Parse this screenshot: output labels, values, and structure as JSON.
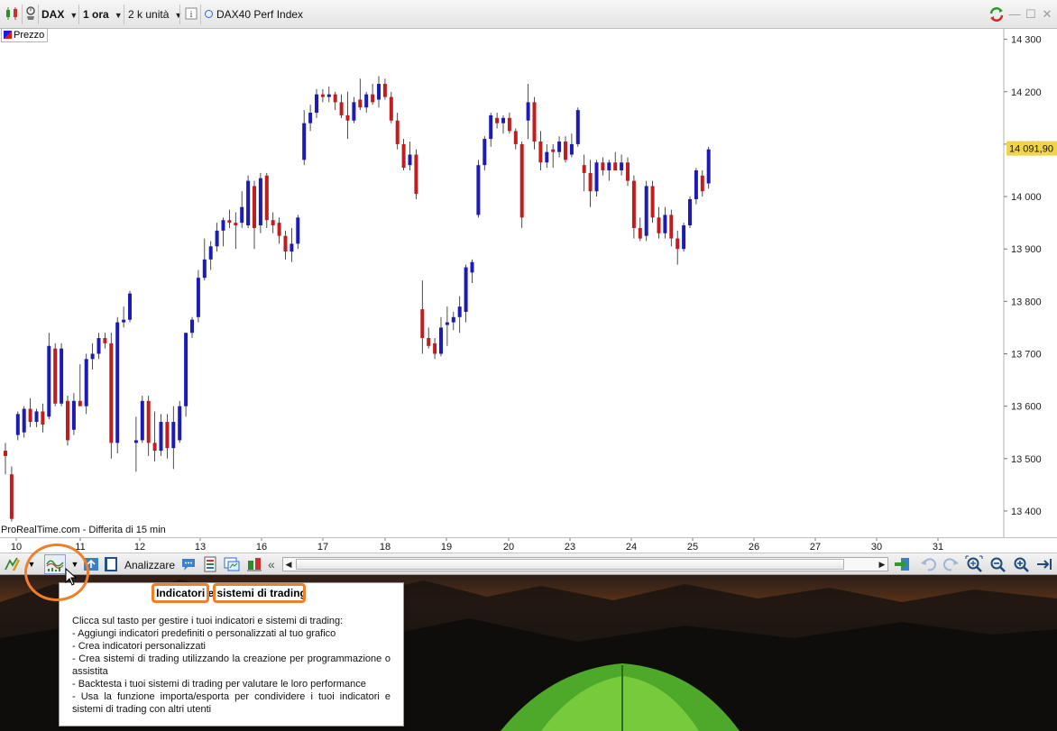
{
  "topbar": {
    "symbol": "DAX",
    "timeframe": "1 ora",
    "units": "2 k unità",
    "instrument": "DAX40 Perf Index",
    "icons": [
      "chart-type-icon",
      "alert-icon",
      "info-icon",
      "sync-icon",
      "minimize-icon",
      "maximize-icon",
      "close-icon"
    ]
  },
  "chart": {
    "legend_label": "Prezzo",
    "credit": "ProRealTime.com - Differita di 15 min",
    "last_price_label": "14 091,90",
    "y_ticks": [
      {
        "value": 14300,
        "label": "14 300"
      },
      {
        "value": 14200,
        "label": "14 200"
      },
      {
        "value": 14100,
        "label": "14 100"
      },
      {
        "value": 14000,
        "label": "14 000"
      },
      {
        "value": 13900,
        "label": "13 900"
      },
      {
        "value": 13800,
        "label": "13 800"
      },
      {
        "value": 13700,
        "label": "13 700"
      },
      {
        "value": 13600,
        "label": "13 600"
      },
      {
        "value": 13500,
        "label": "13 500"
      },
      {
        "value": 13400,
        "label": "13 400"
      }
    ],
    "x_ticks": [
      "10",
      "11",
      "12",
      "13",
      "16",
      "17",
      "18",
      "19",
      "20",
      "23",
      "24",
      "25",
      "26",
      "27",
      "30",
      "31"
    ],
    "colors": {
      "up": "#1c1cb4",
      "down": "#c01e1e",
      "accent": "#f07f2a",
      "price_label_bg": "#f0d54a"
    }
  },
  "toolbar": {
    "analyze_label": "Analizzare",
    "icons": [
      "drawing-tools-icon",
      "indicators-icon",
      "arrange-icon",
      "book-icon",
      "comment-icon",
      "report-icon",
      "screener-icon",
      "trading-systems-icon",
      "collapse-icon",
      "sync-arrows-icon",
      "undo-icon",
      "redo-icon",
      "zoom-fit-icon",
      "zoom-out-icon",
      "zoom-in-icon",
      "scroll-end-icon"
    ]
  },
  "tooltip": {
    "title_part1": "Indicatori",
    "title_mid": " e ",
    "title_part2": "sistemi di trading",
    "lines": [
      "Clicca sul tasto per gestire i tuoi indicatori e sistemi di trading:",
      "- Aggiungi indicatori predefiniti o personalizzati al tuo grafico",
      "- Crea indicatori personalizzati",
      "- Crea sistemi di trading utilizzando la creazione per programmazione o assistita",
      "- Backtesta i tuoi sistemi di trading per valutare le loro performance",
      "- Usa la funzione importa/esporta per condividere i tuoi indicatori e sistemi di trading con altri utenti"
    ]
  },
  "chart_data": {
    "type": "candlestick",
    "ylim": [
      13350,
      14320
    ],
    "x_session_labels": [
      "10",
      "11",
      "12",
      "13",
      "16",
      "17",
      "18",
      "19",
      "20",
      "23",
      "24",
      "25",
      "26"
    ],
    "candles": [
      {
        "o": 13515,
        "h": 13530,
        "l": 13470,
        "c": 13505
      },
      {
        "o": 13470,
        "h": 13485,
        "l": 13380,
        "c": 13385
      },
      {
        "o": 13545,
        "h": 13590,
        "l": 13535,
        "c": 13585
      },
      {
        "o": 13550,
        "h": 13600,
        "l": 13540,
        "c": 13595
      },
      {
        "o": 13595,
        "h": 13615,
        "l": 13560,
        "c": 13570
      },
      {
        "o": 13570,
        "h": 13595,
        "l": 13560,
        "c": 13590
      },
      {
        "o": 13590,
        "h": 13605,
        "l": 13550,
        "c": 13565
      },
      {
        "o": 13580,
        "h": 13740,
        "l": 13575,
        "c": 13715
      },
      {
        "o": 13710,
        "h": 13720,
        "l": 13600,
        "c": 13605
      },
      {
        "o": 13605,
        "h": 13720,
        "l": 13600,
        "c": 13710
      },
      {
        "o": 13610,
        "h": 13620,
        "l": 13525,
        "c": 13535
      },
      {
        "o": 13555,
        "h": 13625,
        "l": 13545,
        "c": 13610
      },
      {
        "o": 13610,
        "h": 13680,
        "l": 13600,
        "c": 13600
      },
      {
        "o": 13600,
        "h": 13700,
        "l": 13585,
        "c": 13690
      },
      {
        "o": 13690,
        "h": 13720,
        "l": 13670,
        "c": 13700
      },
      {
        "o": 13700,
        "h": 13740,
        "l": 13690,
        "c": 13730
      },
      {
        "o": 13730,
        "h": 13740,
        "l": 13710,
        "c": 13720
      },
      {
        "o": 13720,
        "h": 13740,
        "l": 13500,
        "c": 13530
      },
      {
        "o": 13530,
        "h": 13770,
        "l": 13510,
        "c": 13760
      },
      {
        "o": 13760,
        "h": 13790,
        "l": 13750,
        "c": 13765
      },
      {
        "o": 13765,
        "h": 13820,
        "l": 13760,
        "c": 13815
      },
      {
        "o": 13530,
        "h": 13580,
        "l": 13475,
        "c": 13535
      },
      {
        "o": 13535,
        "h": 13620,
        "l": 13530,
        "c": 13610
      },
      {
        "o": 13610,
        "h": 13620,
        "l": 13505,
        "c": 13530
      },
      {
        "o": 13530,
        "h": 13590,
        "l": 13495,
        "c": 13515
      },
      {
        "o": 13515,
        "h": 13585,
        "l": 13505,
        "c": 13570
      },
      {
        "o": 13570,
        "h": 13585,
        "l": 13500,
        "c": 13520
      },
      {
        "o": 13520,
        "h": 13600,
        "l": 13480,
        "c": 13570
      },
      {
        "o": 13535,
        "h": 13610,
        "l": 13530,
        "c": 13600
      },
      {
        "o": 13600,
        "h": 13740,
        "l": 13580,
        "c": 13740
      },
      {
        "o": 13740,
        "h": 13770,
        "l": 13730,
        "c": 13765
      },
      {
        "o": 13770,
        "h": 13860,
        "l": 13760,
        "c": 13845
      },
      {
        "o": 13845,
        "h": 13920,
        "l": 13840,
        "c": 13880
      },
      {
        "o": 13880,
        "h": 13915,
        "l": 13860,
        "c": 13905
      },
      {
        "o": 13905,
        "h": 13950,
        "l": 13895,
        "c": 13935
      },
      {
        "o": 13935,
        "h": 13960,
        "l": 13905,
        "c": 13955
      },
      {
        "o": 13955,
        "h": 13975,
        "l": 13940,
        "c": 13950
      },
      {
        "o": 13950,
        "h": 13970,
        "l": 13900,
        "c": 13945
      },
      {
        "o": 13950,
        "h": 14010,
        "l": 13940,
        "c": 13980
      },
      {
        "o": 13945,
        "h": 14040,
        "l": 13940,
        "c": 14030
      },
      {
        "o": 14020,
        "h": 14030,
        "l": 13900,
        "c": 13940
      },
      {
        "o": 13945,
        "h": 14045,
        "l": 13930,
        "c": 14035
      },
      {
        "o": 14040,
        "h": 14045,
        "l": 13940,
        "c": 13955
      },
      {
        "o": 13955,
        "h": 13970,
        "l": 13930,
        "c": 13945
      },
      {
        "o": 13950,
        "h": 13960,
        "l": 13910,
        "c": 13925
      },
      {
        "o": 13925,
        "h": 13935,
        "l": 13880,
        "c": 13895
      },
      {
        "o": 13895,
        "h": 13940,
        "l": 13875,
        "c": 13910
      },
      {
        "o": 13910,
        "h": 13965,
        "l": 13900,
        "c": 13960
      },
      {
        "o": 14070,
        "h": 14165,
        "l": 14060,
        "c": 14140
      },
      {
        "o": 14140,
        "h": 14175,
        "l": 14125,
        "c": 14160
      },
      {
        "o": 14160,
        "h": 14205,
        "l": 14150,
        "c": 14195
      },
      {
        "o": 14195,
        "h": 14205,
        "l": 14180,
        "c": 14190
      },
      {
        "o": 14190,
        "h": 14210,
        "l": 14180,
        "c": 14195
      },
      {
        "o": 14195,
        "h": 14200,
        "l": 14165,
        "c": 14180
      },
      {
        "o": 14180,
        "h": 14195,
        "l": 14150,
        "c": 14155
      },
      {
        "o": 14155,
        "h": 14200,
        "l": 14110,
        "c": 14145
      },
      {
        "o": 14145,
        "h": 14190,
        "l": 14140,
        "c": 14180
      },
      {
        "o": 14185,
        "h": 14225,
        "l": 14165,
        "c": 14170
      },
      {
        "o": 14170,
        "h": 14200,
        "l": 14160,
        "c": 14195
      },
      {
        "o": 14195,
        "h": 14215,
        "l": 14175,
        "c": 14180
      },
      {
        "o": 14185,
        "h": 14230,
        "l": 14170,
        "c": 14215
      },
      {
        "o": 14215,
        "h": 14225,
        "l": 14185,
        "c": 14190
      },
      {
        "o": 14190,
        "h": 14200,
        "l": 14140,
        "c": 14145
      },
      {
        "o": 14145,
        "h": 14160,
        "l": 14090,
        "c": 14100
      },
      {
        "o": 14100,
        "h": 14110,
        "l": 14050,
        "c": 14055
      },
      {
        "o": 14060,
        "h": 14105,
        "l": 14050,
        "c": 14080
      },
      {
        "o": 14080,
        "h": 14090,
        "l": 13995,
        "c": 14005
      },
      {
        "o": 13785,
        "h": 13840,
        "l": 13700,
        "c": 13730
      },
      {
        "o": 13730,
        "h": 13750,
        "l": 13710,
        "c": 13715
      },
      {
        "o": 13720,
        "h": 13730,
        "l": 13690,
        "c": 13700
      },
      {
        "o": 13700,
        "h": 13770,
        "l": 13695,
        "c": 13750
      },
      {
        "o": 13755,
        "h": 13790,
        "l": 13715,
        "c": 13760
      },
      {
        "o": 13760,
        "h": 13780,
        "l": 13745,
        "c": 13770
      },
      {
        "o": 13770,
        "h": 13810,
        "l": 13740,
        "c": 13790
      },
      {
        "o": 13780,
        "h": 13870,
        "l": 13760,
        "c": 13865
      },
      {
        "o": 13855,
        "h": 13880,
        "l": 13835,
        "c": 13875
      },
      {
        "o": 13965,
        "h": 14070,
        "l": 13960,
        "c": 14060
      },
      {
        "o": 14060,
        "h": 14115,
        "l": 14050,
        "c": 14110
      },
      {
        "o": 14110,
        "h": 14160,
        "l": 14095,
        "c": 14155
      },
      {
        "o": 14150,
        "h": 14160,
        "l": 14130,
        "c": 14140
      },
      {
        "o": 14140,
        "h": 14155,
        "l": 14120,
        "c": 14150
      },
      {
        "o": 14150,
        "h": 14160,
        "l": 14120,
        "c": 14125
      },
      {
        "o": 14125,
        "h": 14130,
        "l": 14090,
        "c": 14100
      },
      {
        "o": 14100,
        "h": 14105,
        "l": 13940,
        "c": 13960
      },
      {
        "o": 14145,
        "h": 14215,
        "l": 14110,
        "c": 14180
      },
      {
        "o": 14180,
        "h": 14190,
        "l": 14090,
        "c": 14105
      },
      {
        "o": 14105,
        "h": 14125,
        "l": 14050,
        "c": 14065
      },
      {
        "o": 14065,
        "h": 14100,
        "l": 14055,
        "c": 14085
      },
      {
        "o": 14090,
        "h": 14100,
        "l": 14055,
        "c": 14085
      },
      {
        "o": 14085,
        "h": 14115,
        "l": 14075,
        "c": 14105
      },
      {
        "o": 14105,
        "h": 14115,
        "l": 14065,
        "c": 14070
      },
      {
        "o": 14080,
        "h": 14120,
        "l": 14075,
        "c": 14100
      },
      {
        "o": 14100,
        "h": 14170,
        "l": 14095,
        "c": 14165
      },
      {
        "o": 14060,
        "h": 14080,
        "l": 14010,
        "c": 14045
      },
      {
        "o": 14045,
        "h": 14070,
        "l": 13980,
        "c": 14010
      },
      {
        "o": 14010,
        "h": 14070,
        "l": 14000,
        "c": 14065
      },
      {
        "o": 14065,
        "h": 14075,
        "l": 14040,
        "c": 14050
      },
      {
        "o": 14050,
        "h": 14070,
        "l": 14030,
        "c": 14065
      },
      {
        "o": 14065,
        "h": 14085,
        "l": 14050,
        "c": 14050
      },
      {
        "o": 14050,
        "h": 14080,
        "l": 14040,
        "c": 14065
      },
      {
        "o": 14065,
        "h": 14075,
        "l": 14020,
        "c": 14030
      },
      {
        "o": 14030,
        "h": 14040,
        "l": 13920,
        "c": 13940
      },
      {
        "o": 13940,
        "h": 13960,
        "l": 13915,
        "c": 13920
      },
      {
        "o": 13925,
        "h": 14030,
        "l": 13915,
        "c": 14020
      },
      {
        "o": 14020,
        "h": 14030,
        "l": 13950,
        "c": 13960
      },
      {
        "o": 13960,
        "h": 13980,
        "l": 13920,
        "c": 13930
      },
      {
        "o": 13930,
        "h": 13980,
        "l": 13920,
        "c": 13965
      },
      {
        "o": 13965,
        "h": 13975,
        "l": 13905,
        "c": 13920
      },
      {
        "o": 13920,
        "h": 13935,
        "l": 13870,
        "c": 13900
      },
      {
        "o": 13900,
        "h": 13950,
        "l": 13895,
        "c": 13945
      },
      {
        "o": 13945,
        "h": 14000,
        "l": 13940,
        "c": 13995
      },
      {
        "o": 13995,
        "h": 14055,
        "l": 13985,
        "c": 14050
      },
      {
        "o": 14040,
        "h": 14050,
        "l": 14000,
        "c": 14010
      },
      {
        "o": 14025,
        "h": 14095,
        "l": 14015,
        "c": 14090
      }
    ]
  }
}
